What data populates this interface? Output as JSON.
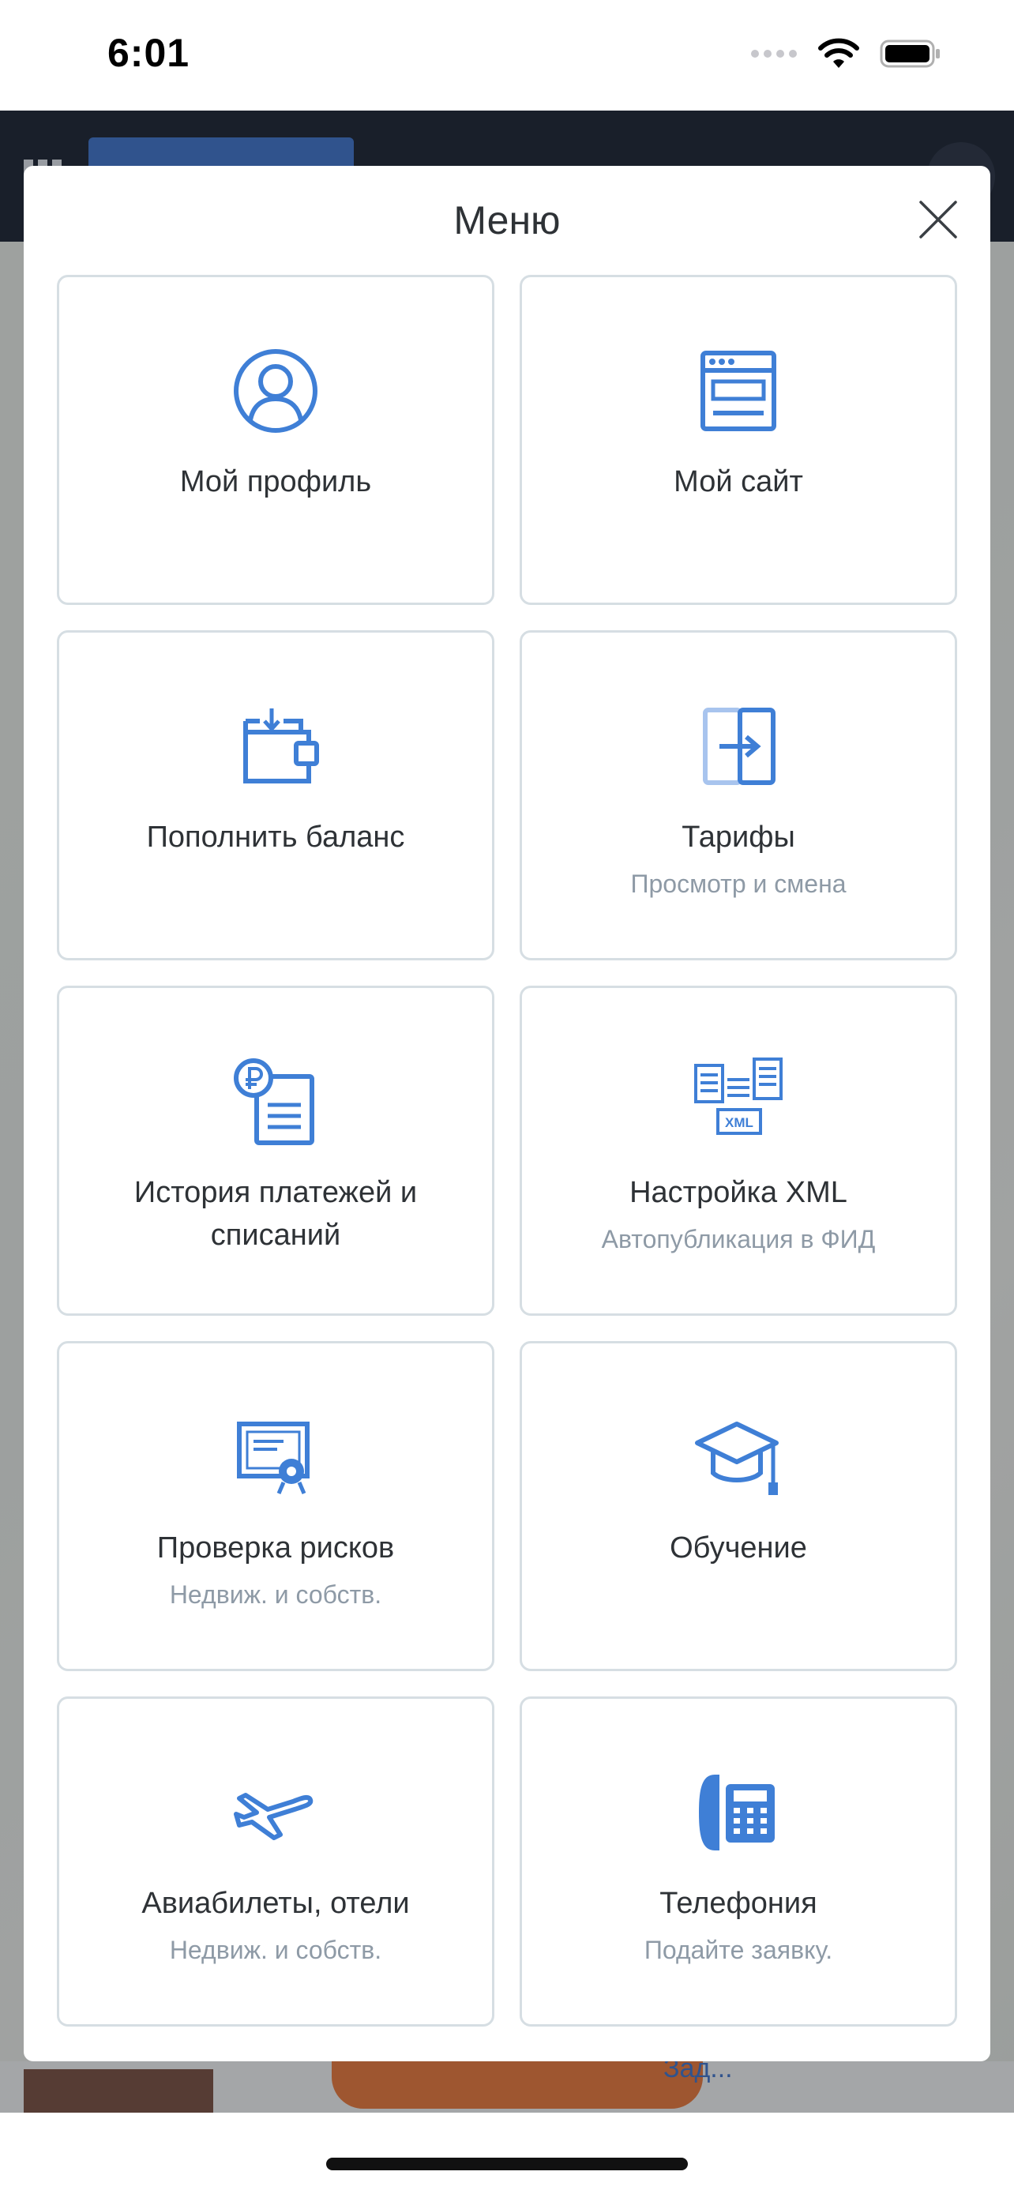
{
  "status_bar": {
    "time": "6:01"
  },
  "modal": {
    "title": "Меню",
    "items": [
      {
        "label": "Мой профиль",
        "subtitle": "",
        "icon": "user-circle-icon"
      },
      {
        "label": "Мой сайт",
        "subtitle": "",
        "icon": "browser-window-icon"
      },
      {
        "label": "Пополнить баланс",
        "subtitle": "",
        "icon": "wallet-icon"
      },
      {
        "label": "Тарифы",
        "subtitle": "Просмотр и смена",
        "icon": "switch-plan-icon"
      },
      {
        "label": "История платежей и списаний",
        "subtitle": "",
        "icon": "ruble-document-icon"
      },
      {
        "label": "Настройка XML",
        "subtitle": "Автопубликация в ФИД",
        "icon": "xml-feed-icon"
      },
      {
        "label": "Проверка рисков",
        "subtitle": "Недвиж. и собств.",
        "icon": "certificate-icon"
      },
      {
        "label": "Обучение",
        "subtitle": "",
        "icon": "graduation-cap-icon"
      },
      {
        "label": "Авиабилеты, отели",
        "subtitle": "Недвиж. и собств.",
        "icon": "airplane-icon"
      },
      {
        "label": "Телефония",
        "subtitle": "Подайте заявку.",
        "icon": "telephone-icon"
      }
    ]
  },
  "background": {
    "tab_bar_text": "Зад..."
  },
  "colors": {
    "accent": "#3f7fd6",
    "border": "#d6dee3",
    "subtitle": "#8e9aa6"
  }
}
